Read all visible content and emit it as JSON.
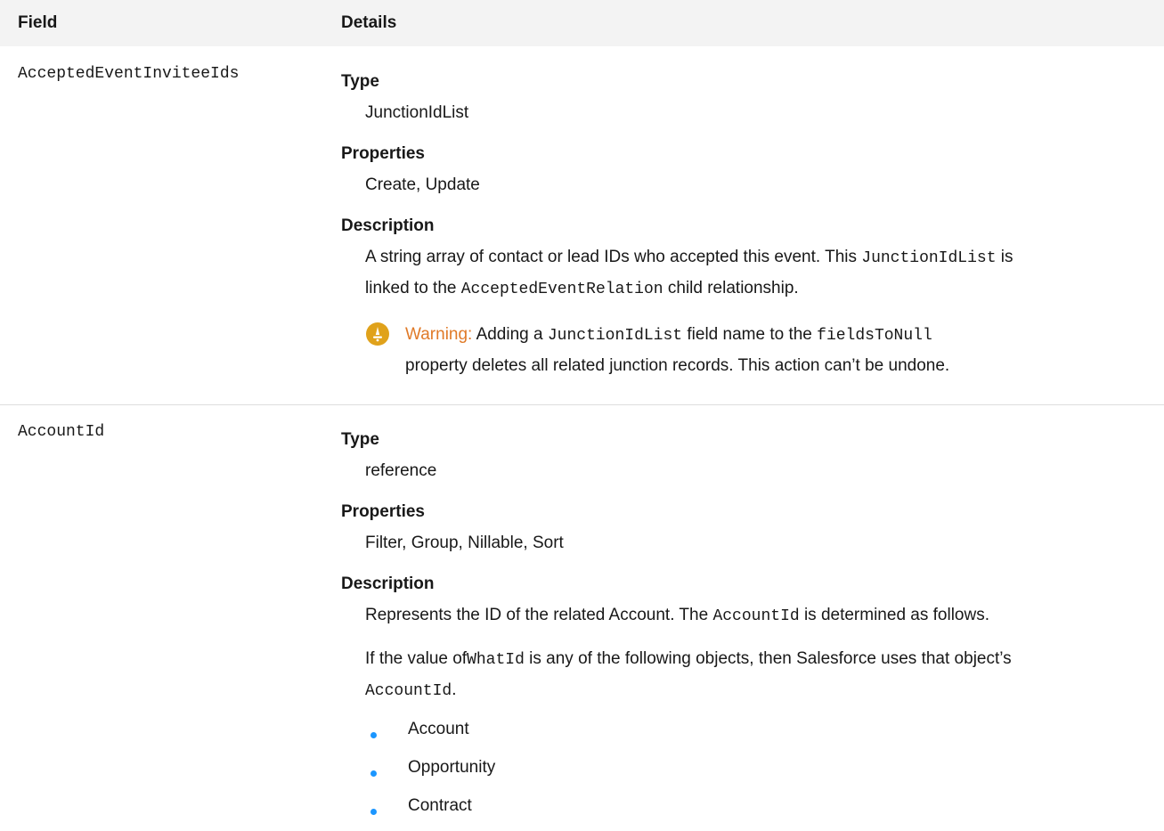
{
  "header": {
    "field": "Field",
    "details": "Details"
  },
  "rows": [
    {
      "field": "AcceptedEventInviteeIds",
      "type_label": "Type",
      "type": "JunctionIdList",
      "properties_label": "Properties",
      "properties": "Create, Update",
      "description_label": "Description",
      "desc_part1": "A string array of contact or lead IDs who accepted this event. This",
      "desc_code1": "JunctionIdList",
      "desc_part2": "is",
      "desc_part3": "linked to the",
      "desc_code2": "AcceptedEventRelation",
      "desc_part4": "child relationship.",
      "warning_label": "Warning:",
      "warning_part1": "Adding a",
      "warning_code1": "JunctionIdList",
      "warning_part2": "field name to the",
      "warning_code2": "fieldsToNull",
      "warning_line2": "property deletes all related junction records. This action can’t be undone."
    },
    {
      "field": "AccountId",
      "type_label": "Type",
      "type": "reference",
      "properties_label": "Properties",
      "properties": "Filter, Group, Nillable, Sort",
      "description_label": "Description",
      "desc_part1": "Represents the ID of the related Account. The",
      "desc_code1": "AccountId",
      "desc_part2": "is determined as follows.",
      "desc2_part1": "If the value of",
      "desc2_code1": "WhatId",
      "desc2_part2": "is any of the following objects, then Salesforce uses that object’s",
      "desc2_code2": "AccountId",
      "desc2_part3": ".",
      "bullets": [
        "Account",
        "Opportunity",
        "Contract"
      ]
    }
  ],
  "colors": {
    "header_bg": "#f3f3f3",
    "rule": "#dddddd",
    "warning_orange": "#e07a28",
    "warning_icon": "#e0a21b",
    "bullet_blue": "#1b96ff"
  }
}
